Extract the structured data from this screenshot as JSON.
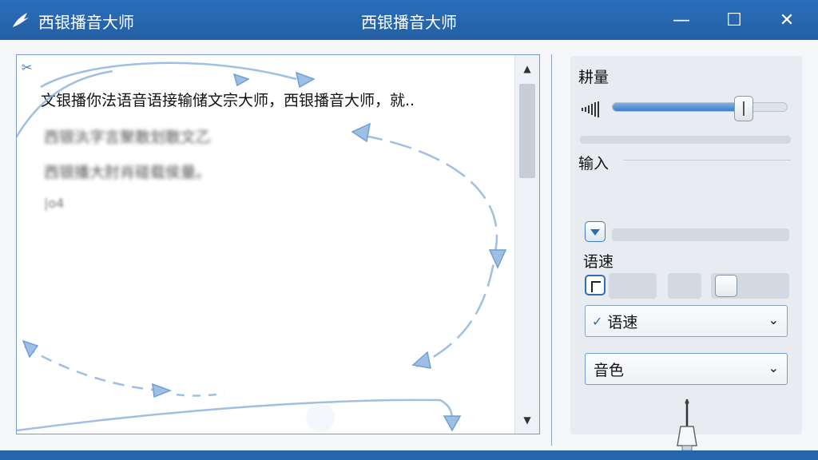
{
  "window": {
    "app_name": "西银播音大师",
    "title": "西银播音大师",
    "minimize_label": "—",
    "maximize_label": "☐",
    "close_label": "✕"
  },
  "editor": {
    "text_line": "文银播你法语音语接输储文宗大师，西银播音大师，就..",
    "blurred_lines": [
      "西银汍字言聚散划散文乙",
      "西银播大肘肖碰载侯量。"
    ],
    "cursor_text": "|o4",
    "scissors_icon": "✂",
    "scroll_up": "▲",
    "scroll_down": "▼"
  },
  "panel": {
    "volume_label": "耕量",
    "volume_level": 0.75,
    "input_label": "输入",
    "speed_label": "语速",
    "speed_select": {
      "check": "✓",
      "value": "语速",
      "chevron": "⌄"
    },
    "voice_select": {
      "value": "音色",
      "chevron": "⌄"
    }
  },
  "colors": {
    "titlebar": "#2a6fba",
    "accent": "#3e7fc6",
    "panel_bg": "#e8ecf1"
  }
}
